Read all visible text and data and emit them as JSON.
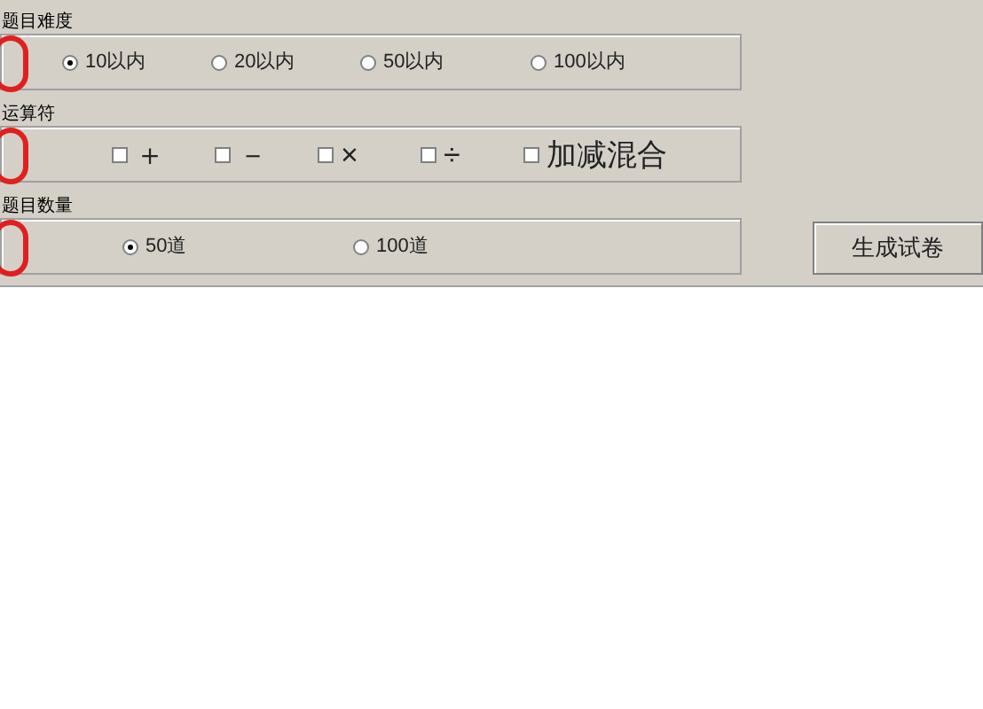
{
  "groups": [
    {
      "label": "题目难度",
      "kind": "radio",
      "items": [
        {
          "label": "10以内",
          "selected": true
        },
        {
          "label": "20以内",
          "selected": false
        },
        {
          "label": "50以内",
          "selected": false
        },
        {
          "label": "100以内",
          "selected": false
        }
      ]
    },
    {
      "label": "运算符",
      "kind": "checkbox",
      "items": [
        {
          "label": "＋",
          "checked": false
        },
        {
          "label": "－",
          "checked": false
        },
        {
          "label": "×",
          "checked": false
        },
        {
          "label": "÷",
          "checked": false
        },
        {
          "label": "加减混合",
          "checked": false
        }
      ]
    },
    {
      "label": "题目数量",
      "kind": "radio",
      "items": [
        {
          "label": "50道",
          "selected": true
        },
        {
          "label": "100道",
          "selected": false
        }
      ]
    }
  ],
  "button": "生成试卷"
}
